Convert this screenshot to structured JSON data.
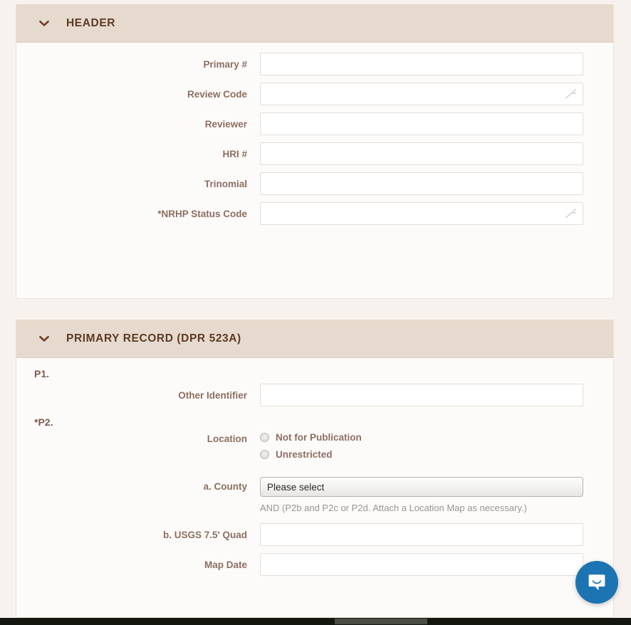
{
  "sections": [
    {
      "id": "header",
      "title": "HEADER",
      "collapse_icon": "chevron-down-icon",
      "fields": [
        {
          "label": "Primary #",
          "type": "text",
          "value": "",
          "placeholder": "",
          "widget_icon": null
        },
        {
          "label": "Review Code",
          "type": "text",
          "value": "",
          "placeholder": "",
          "widget_icon": "wrench-icon"
        },
        {
          "label": "Reviewer",
          "type": "text",
          "value": "",
          "placeholder": "",
          "widget_icon": null
        },
        {
          "label": "HRI #",
          "type": "text",
          "value": "",
          "placeholder": "",
          "widget_icon": null
        },
        {
          "label": "Trinomial",
          "type": "text",
          "value": "",
          "placeholder": "",
          "widget_icon": null
        },
        {
          "label": "*NRHP Status Code",
          "type": "text",
          "value": "",
          "placeholder": "",
          "widget_icon": "wrench-icon"
        }
      ]
    },
    {
      "id": "primary_record",
      "title": "PRIMARY RECORD (DPR 523A)",
      "collapse_icon": "chevron-down-icon",
      "p1_number": "P1.",
      "p2_number": "*P2.",
      "other_identifier_label": "Other Identifier",
      "other_identifier_value": "",
      "location_label": "Location",
      "location_options": [
        {
          "label": "Not for Publication",
          "selected": false
        },
        {
          "label": "Unrestricted",
          "selected": false
        }
      ],
      "county_label": "a. County",
      "county_selected": "Please select",
      "county_options": [
        "Please select"
      ],
      "helper_text": "AND (P2b and P2c or P2d. Attach a Location Map as necessary.)",
      "quad_label": "b. USGS 7.5' Quad",
      "quad_value": "",
      "map_date_label": "Map Date",
      "map_date_value": ""
    }
  ],
  "chat_widget": {
    "icon": "chat-bubble-icon",
    "color": "#1c74b2"
  },
  "colors": {
    "page_background": "#f7f2ee",
    "panel_background": "#fdfbf9",
    "section_bar": "#e6dace",
    "section_title": "#5c3a24",
    "label": "#8c6e63",
    "helper": "#9a9490",
    "input_border": "#e3ddd7",
    "chat_blue": "#1c74b2",
    "os_bar": "#14170f",
    "scroll_thumb": "#4a4e44"
  }
}
